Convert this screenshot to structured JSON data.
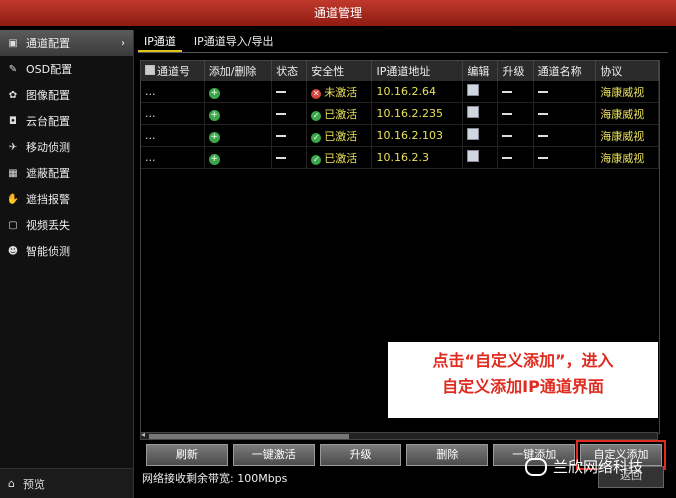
{
  "window": {
    "title": "通道管理"
  },
  "sidebar": {
    "items": [
      {
        "label": "通道配置",
        "icon": "camera-icon"
      },
      {
        "label": "OSD配置",
        "icon": "edit-icon"
      },
      {
        "label": "图像配置",
        "icon": "image-icon"
      },
      {
        "label": "云台配置",
        "icon": "ptz-icon"
      },
      {
        "label": "移动侦测",
        "icon": "motion-icon"
      },
      {
        "label": "遮蔽配置",
        "icon": "mask-icon"
      },
      {
        "label": "遮挡报警",
        "icon": "hand-icon"
      },
      {
        "label": "视频丢失",
        "icon": "video-loss-icon"
      },
      {
        "label": "智能侦测",
        "icon": "smart-icon"
      }
    ],
    "preview_label": "预览"
  },
  "tabs": [
    "IP通道",
    "IP通道导入/导出"
  ],
  "table": {
    "headers": [
      "通道号",
      "添加/删除",
      "状态",
      "安全性",
      "IP通道地址",
      "编辑",
      "升级",
      "通道名称",
      "协议"
    ],
    "rows": [
      {
        "ch": "...",
        "security": "未激活",
        "ip": "10.16.2.64",
        "proto": "海康威视",
        "active": false
      },
      {
        "ch": "...",
        "security": "已激活",
        "ip": "10.16.2.235",
        "proto": "海康威视",
        "active": true
      },
      {
        "ch": "...",
        "security": "已激活",
        "ip": "10.16.2.103",
        "proto": "海康威视",
        "active": true
      },
      {
        "ch": "...",
        "security": "已激活",
        "ip": "10.16.2.3",
        "proto": "海康威视",
        "active": true
      }
    ]
  },
  "buttons": [
    "刷新",
    "一键激活",
    "升级",
    "删除",
    "一键添加",
    "自定义添加"
  ],
  "bandwidth": "网络接收剩余带宽: 100Mbps",
  "annotation": {
    "line1": "点击“自定义添加”，进入",
    "line2": "自定义添加IP通道界面"
  },
  "return_label": "返回",
  "watermark": "兰欣网络科技",
  "colors": {
    "title_bar": "#b0281c",
    "highlight": "#e9e15b",
    "annotation_red": "#e02b20"
  }
}
